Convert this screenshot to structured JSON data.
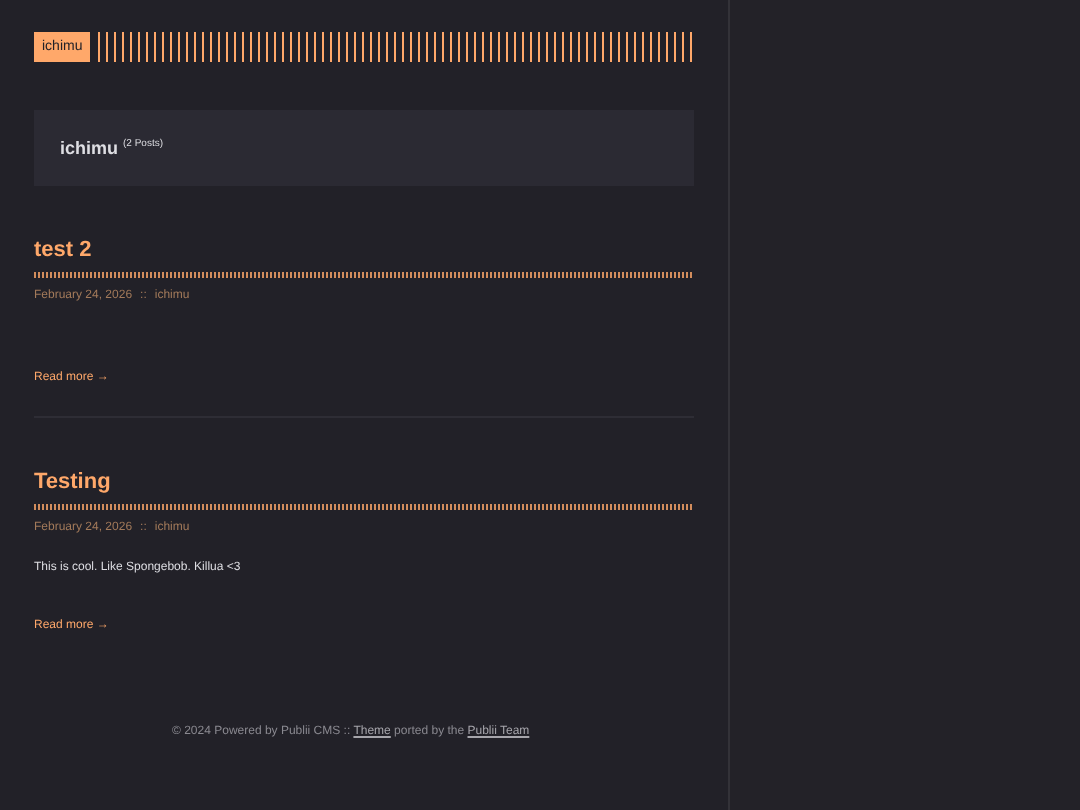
{
  "header": {
    "logo": "ichimu"
  },
  "author_box": {
    "name": "ichimu",
    "count": "(2 Posts)"
  },
  "posts": [
    {
      "title": "test 2",
      "date": "February 24, 2026",
      "separator": "::",
      "author": "ichimu",
      "read_more": "Read more →"
    },
    {
      "title": "Testing",
      "date": "February 24, 2026",
      "separator": "::",
      "author": "ichimu",
      "excerpt": "This is cool. Like Spongebob. Killua <3",
      "read_more": "Read more →"
    }
  ],
  "footer": {
    "text_before": "© 2024 Powered by Publii CMS :: ",
    "link_1": "Theme",
    "text_middle": " ported by the ",
    "link_2": "Publii Team"
  }
}
